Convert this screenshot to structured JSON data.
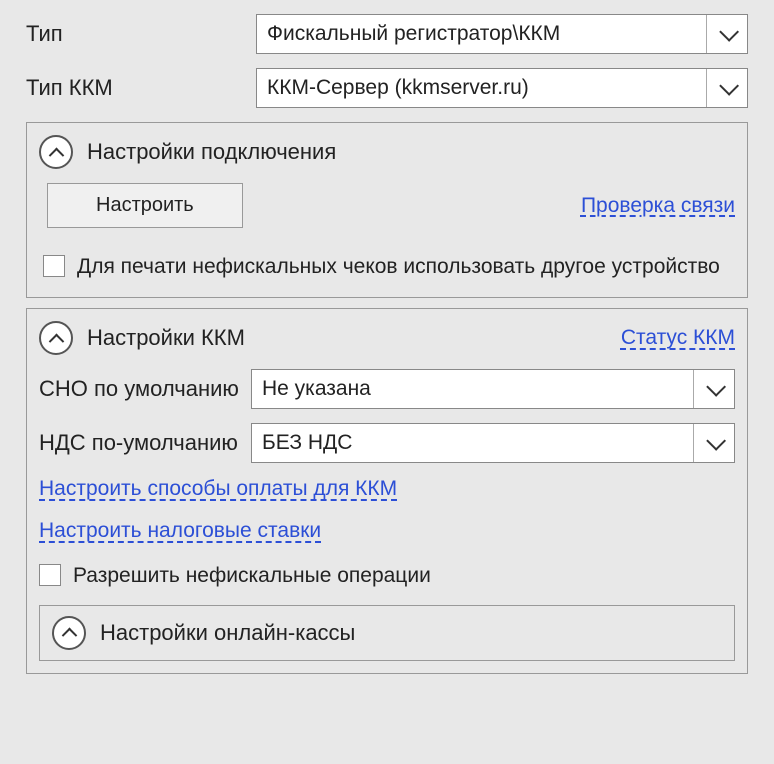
{
  "top": {
    "type_label": "Тип",
    "type_value": "Фискальный регистратор\\ККМ",
    "kkm_type_label": "Тип ККМ",
    "kkm_type_value": "ККМ-Сервер (kkmserver.ru)"
  },
  "connection": {
    "title": "Настройки подключения",
    "configure_btn": "Настроить",
    "check_link": "Проверка связи",
    "nonfiscal_checkbox": "Для печати нефискальных чеков использовать другое устройство"
  },
  "kkm": {
    "title": "Настройки ККМ",
    "status_link": "Статус ККМ",
    "sno_label": "СНО по умолчанию",
    "sno_value": "Не указана",
    "nds_label": "НДС по-умолчанию",
    "nds_value": "БЕЗ НДС",
    "payment_link": "Настроить способы оплаты для ККМ",
    "tax_link": "Настроить налоговые ставки",
    "allow_nonfiscal": "Разрешить нефискальные операции"
  },
  "online": {
    "title": "Настройки онлайн-кассы"
  }
}
